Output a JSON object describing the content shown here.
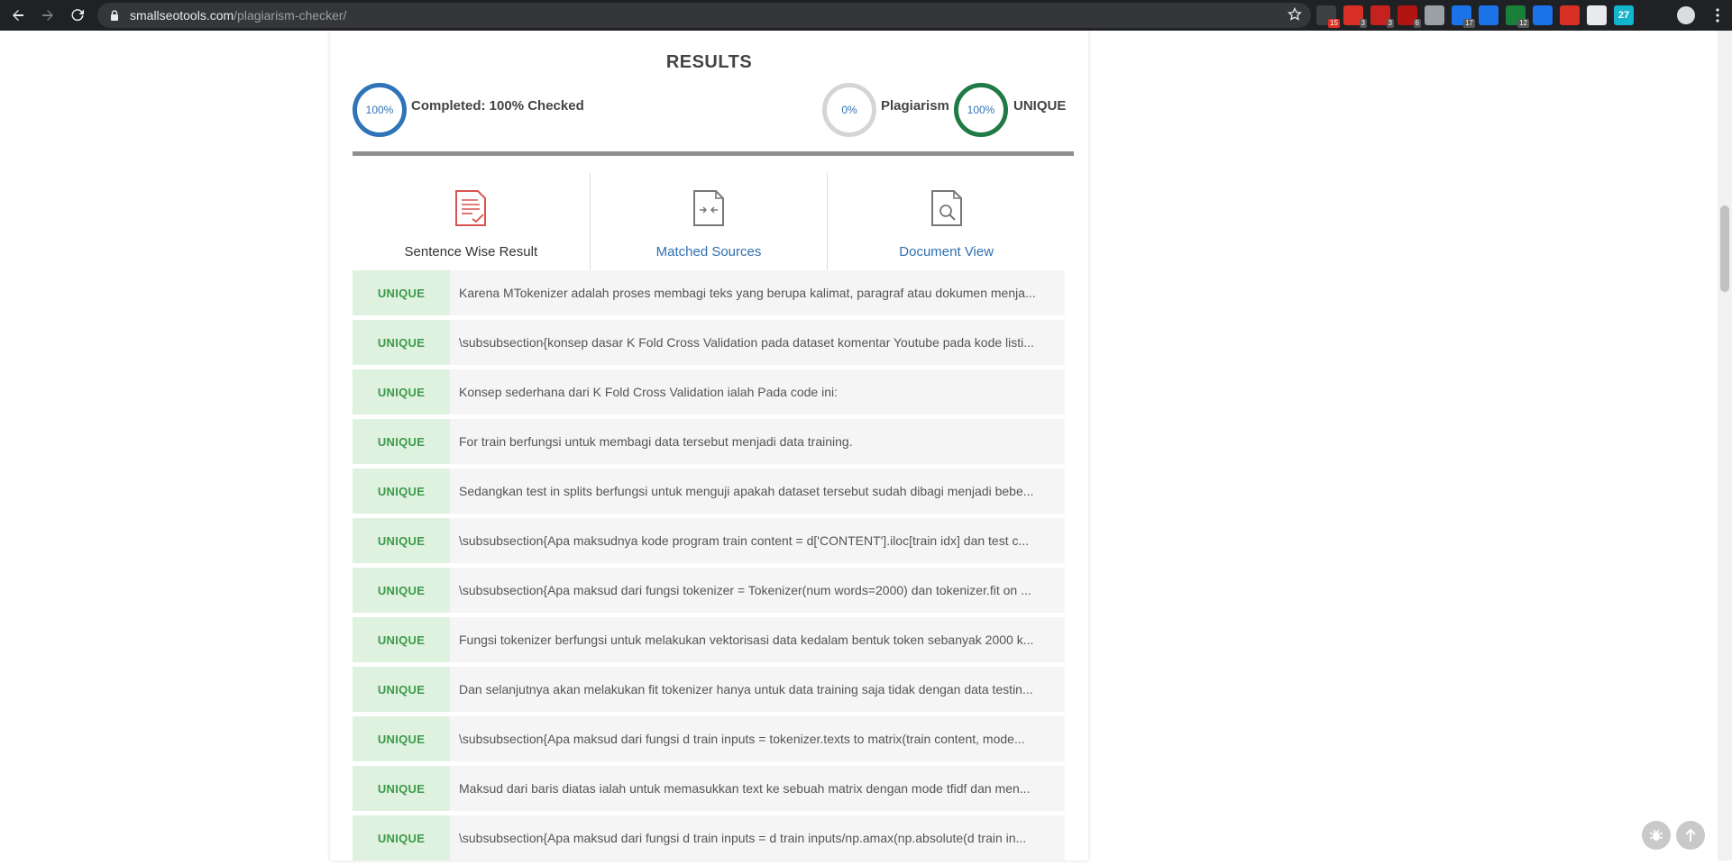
{
  "browser": {
    "url_domain": "smallseotools.com",
    "url_path": "/plagiarism-checker/",
    "extensions": [
      {
        "name": "ext-1",
        "badge": "15",
        "color": "#3c4043",
        "badge_red": true
      },
      {
        "name": "ext-2",
        "badge": "3",
        "color": "#d93025",
        "badge_red": false
      },
      {
        "name": "ext-3",
        "badge": "3",
        "color": "#c5221f",
        "badge_red": false
      },
      {
        "name": "ext-4",
        "badge": "6",
        "color": "#b31412",
        "badge_red": false
      },
      {
        "name": "ext-5",
        "badge": "",
        "color": "#9aa0a6",
        "badge_red": false
      },
      {
        "name": "ext-6",
        "badge": "17",
        "color": "#1a73e8",
        "badge_red": false
      },
      {
        "name": "ext-7",
        "badge": "",
        "color": "#1a73e8",
        "badge_red": false
      },
      {
        "name": "ext-8",
        "badge": "12",
        "color": "#188038",
        "badge_red": false
      },
      {
        "name": "ext-9",
        "badge": "",
        "color": "#1a73e8",
        "badge_red": false
      },
      {
        "name": "ext-10",
        "badge": "",
        "color": "#d93025",
        "badge_red": false
      },
      {
        "name": "ext-11",
        "badge": "",
        "color": "#e8eaed",
        "badge_red": false
      },
      {
        "name": "ext-12",
        "badge": "",
        "color": "#12b5cb",
        "badge_red": false
      }
    ],
    "ext_12_text": "27"
  },
  "results": {
    "title": "RESULTS",
    "completed_pct": "100%",
    "completed_label": "Completed: 100% Checked",
    "plagiarism_pct": "0%",
    "plagiarism_label": "Plagiarism",
    "unique_pct": "100%",
    "unique_label": "UNIQUE"
  },
  "tabs": {
    "sentence": "Sentence Wise Result",
    "sources": "Matched Sources",
    "document": "Document View"
  },
  "rows": [
    {
      "tag": "UNIQUE",
      "text": "Karena MTokenizer adalah proses membagi teks yang berupa kalimat, paragraf atau dokumen menja..."
    },
    {
      "tag": "UNIQUE",
      "text": "\\subsubsection{konsep dasar K Fold Cross Validation pada dataset komentar Youtube pada kode listi..."
    },
    {
      "tag": "UNIQUE",
      "text": "Konsep sederhana dari K Fold Cross Validation ialah Pada code ini:"
    },
    {
      "tag": "UNIQUE",
      "text": "For train berfungsi untuk membagi data tersebut menjadi data training."
    },
    {
      "tag": "UNIQUE",
      "text": "Sedangkan test in splits berfungsi untuk menguji apakah dataset tersebut sudah dibagi menjadi bebe..."
    },
    {
      "tag": "UNIQUE",
      "text": "\\subsubsection{Apa maksudnya kode program train content = d['CONTENT'].iloc[train idx] dan test c..."
    },
    {
      "tag": "UNIQUE",
      "text": "\\subsubsection{Apa maksud dari fungsi tokenizer = Tokenizer(num words=2000) dan tokenizer.fit on ..."
    },
    {
      "tag": "UNIQUE",
      "text": "Fungsi tokenizer berfungsi untuk melakukan vektorisasi data kedalam bentuk token sebanyak 2000 k..."
    },
    {
      "tag": "UNIQUE",
      "text": "Dan selanjutnya akan melakukan fit tokenizer hanya untuk data training saja tidak dengan data testin..."
    },
    {
      "tag": "UNIQUE",
      "text": "\\subsubsection{Apa maksud dari fungsi d train inputs = tokenizer.texts to matrix(train content, mode..."
    },
    {
      "tag": "UNIQUE",
      "text": "Maksud dari baris diatas ialah untuk memasukkan text ke sebuah matrix dengan mode tfidf dan men..."
    },
    {
      "tag": "UNIQUE",
      "text": "\\subsubsection{Apa maksud dari fungsi d train inputs = d train inputs/np.amax(np.absolute(d train in..."
    }
  ],
  "colors": {
    "unique_green": "#3c9a4b",
    "ring_blue": "#2f73b8",
    "ring_green": "#1f7a45",
    "link_blue": "#2f6fb0"
  }
}
